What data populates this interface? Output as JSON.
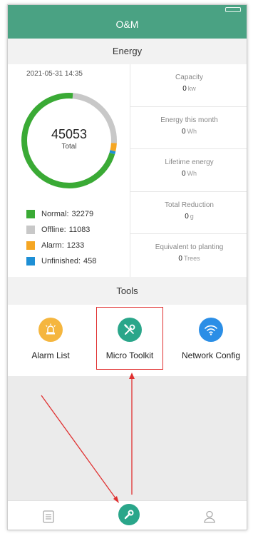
{
  "header": {
    "title": "O&M"
  },
  "status_bar": {
    "time": ""
  },
  "energy": {
    "section_title": "Energy",
    "timestamp": "2021-05-31 14:35",
    "total": {
      "value": "45053",
      "label": "Total"
    },
    "legend": [
      {
        "label": "Normal:",
        "value": "32279",
        "color": "#3aaa35"
      },
      {
        "label": "Offline:",
        "value": "11083",
        "color": "#c8c8c8"
      },
      {
        "label": "Alarm:",
        "value": "1233",
        "color": "#f5a623"
      },
      {
        "label": "Unfinished:",
        "value": "458",
        "color": "#1e8fd5"
      }
    ],
    "stats": [
      {
        "title": "Capacity",
        "value": "0",
        "unit": "kw"
      },
      {
        "title": "Energy this month",
        "value": "0",
        "unit": "Wh"
      },
      {
        "title": "Lifetime energy",
        "value": "0",
        "unit": "Wh"
      },
      {
        "title": "Total Reduction",
        "value": "0",
        "unit": "g"
      },
      {
        "title": "Equivalent to planting",
        "value": "0",
        "unit": "Trees"
      }
    ]
  },
  "tools": {
    "section_title": "Tools",
    "items": [
      {
        "label": "Alarm List",
        "icon": "alarm-light-icon",
        "color": "#f5b63f"
      },
      {
        "label": "Micro Toolkit",
        "icon": "wrench-screwdriver-icon",
        "color": "#2aa68a"
      },
      {
        "label": "Network Config",
        "icon": "wifi-icon",
        "color": "#2b8ee6"
      }
    ]
  },
  "tabbar": {
    "items": [
      {
        "icon": "document-icon"
      },
      {
        "icon": "wrench-icon",
        "active": true
      },
      {
        "icon": "user-icon"
      }
    ]
  },
  "colors": {
    "brand": "#4aa283",
    "annotation": "#e03030"
  }
}
